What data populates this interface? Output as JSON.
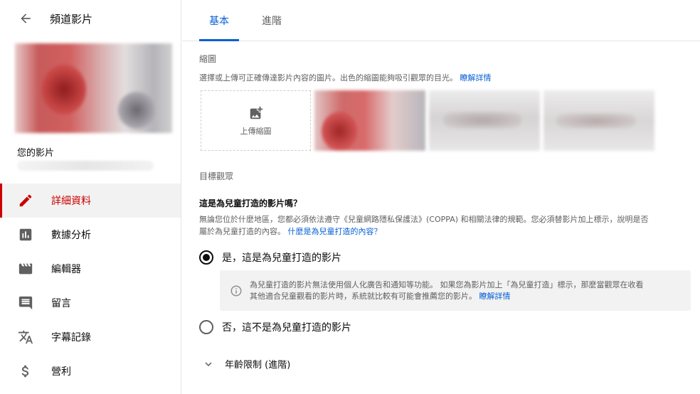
{
  "sidebar": {
    "back_icon": "arrow-back-icon",
    "title": "頻道影片",
    "your_video_label": "您的影片",
    "items": [
      {
        "label": "詳細資料",
        "icon": "pencil-icon",
        "active": true
      },
      {
        "label": "數據分析",
        "icon": "analytics-icon",
        "active": false
      },
      {
        "label": "編輯器",
        "icon": "clapperboard-icon",
        "active": false
      },
      {
        "label": "留言",
        "icon": "comment-icon",
        "active": false
      },
      {
        "label": "字幕記錄",
        "icon": "translate-icon",
        "active": false
      },
      {
        "label": "營利",
        "icon": "dollar-icon",
        "active": false
      }
    ]
  },
  "tabs": [
    {
      "label": "基本",
      "active": true
    },
    {
      "label": "進階",
      "active": false
    }
  ],
  "thumbnail": {
    "section_label": "縮圖",
    "description": "選擇或上傳可正確傳達影片內容的圖片。出色的縮圖能夠吸引觀眾的目光。",
    "learn_more": "瞭解詳情",
    "upload_label": "上傳縮圖"
  },
  "audience": {
    "section_label": "目標觀眾",
    "question": "這是為兒童打造的影片嗎？",
    "description_line1": "無論您位於什麼地區，您都必須依法遵守《兒童網路隱私保護法》(COPPA) 和相關法律的規範。您必須替影片加上標示，說明是否",
    "description_line2": "屬於為兒童打造的內容。",
    "description_link": "什麼是為兒童打造的內容？",
    "option_yes": "是，這是為兒童打造的影片",
    "option_no": "否，這不是為兒童打造的影片",
    "selected": "yes",
    "info_line1": "為兒童打造的影片無法使用個人化廣告和通知等功能。 如果您為影片加上「為兒童打造」標示，那麼當觀眾在收看",
    "info_line2": "其他適合兒童觀看的影片時，系統就比較有可能會推薦您的影片。",
    "info_link": "瞭解詳情"
  },
  "age_restriction": {
    "label": "年齡限制 (進階)"
  },
  "colors": {
    "accent_blue": "#065fd4",
    "active_red": "#cc0000"
  }
}
